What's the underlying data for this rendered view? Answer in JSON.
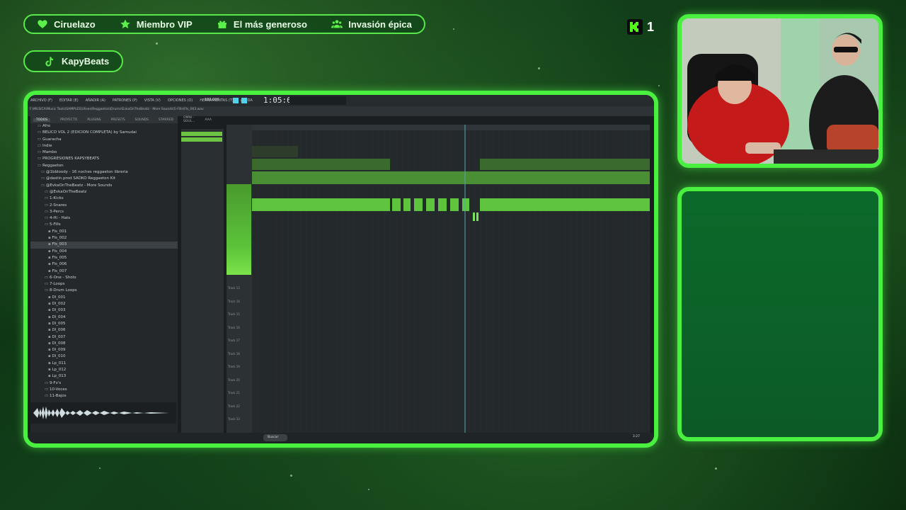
{
  "overlay": {
    "alerts": [
      {
        "icon": "heart-icon",
        "label": "Ciruelazo"
      },
      {
        "icon": "star-icon",
        "label": "Miembro VIP"
      },
      {
        "icon": "gift-icon",
        "label": "El más generoso"
      },
      {
        "icon": "users-icon",
        "label": "Invasión épica"
      }
    ],
    "social": {
      "icon": "tiktok-icon",
      "handle": "KapyBeats"
    },
    "kick": {
      "icon": "kick-logo-icon",
      "viewer_count": "1"
    },
    "colors": {
      "accent": "#49f040",
      "panel": "#0c5a26"
    }
  },
  "fl": {
    "menu": [
      "ARCHIVO (F)",
      "EDITAR (E)",
      "AÑADIR (A)",
      "PATRONES (P)",
      "VISTA (V)",
      "OPCIONES (O)",
      "HERRAMIENTAS (T)",
      "AYUDA"
    ],
    "time": "1:05:62",
    "bpm": "100.000",
    "path": "F:\\MUSICA\\Music Tools\\SAMPLES\\Ulises\\Reggaeton\\Drums\\EvkaOnTheBeatz - More Sounds\\5-Fills\\Fls_003.wav",
    "browser_tabs": [
      "TODOS",
      "PROYECTO",
      "PLUGINS",
      "PRESETS",
      "SOUNDS",
      "STARRED",
      "OMNI - SOUL...",
      "AAA"
    ],
    "browser_items": [
      {
        "label": "Afro",
        "indent": 2,
        "type": "folder"
      },
      {
        "label": "BELICO VOL 2 (EDICION COMPLETA) by Samudai",
        "indent": 2,
        "type": "folder"
      },
      {
        "label": "Guaracha",
        "indent": 2,
        "type": "folder"
      },
      {
        "label": "Indie",
        "indent": 2,
        "type": "folder"
      },
      {
        "label": "Mambo",
        "indent": 2,
        "type": "folder"
      },
      {
        "label": "PROGRESIONES KAPSYBEATS",
        "indent": 2,
        "type": "folder"
      },
      {
        "label": "Reggaeton",
        "indent": 2,
        "type": "folder"
      },
      {
        "label": "@1bbloody - 16 noches reggaeton libreria",
        "indent": 3,
        "type": "folder"
      },
      {
        "label": "@dastin.prod SADKO Reggaeton Kit",
        "indent": 3,
        "type": "folder"
      },
      {
        "label": "@EvkaOnTheBeatz - More Sounds",
        "indent": 3,
        "type": "folder"
      },
      {
        "label": "@EvkaOnTheBeatz",
        "indent": 4,
        "type": "folder"
      },
      {
        "label": "1-Kicks",
        "indent": 4,
        "type": "folder"
      },
      {
        "label": "2-Snares",
        "indent": 4,
        "type": "folder"
      },
      {
        "label": "3-Percs",
        "indent": 4,
        "type": "folder"
      },
      {
        "label": "4-Hi - Hats",
        "indent": 4,
        "type": "folder"
      },
      {
        "label": "5-Fills",
        "indent": 4,
        "type": "folder"
      },
      {
        "label": "Fls_001",
        "indent": 5,
        "type": "file"
      },
      {
        "label": "Fls_002",
        "indent": 5,
        "type": "file"
      },
      {
        "label": "Fls_003",
        "indent": 5,
        "type": "file",
        "selected": true
      },
      {
        "label": "Fls_004",
        "indent": 5,
        "type": "file"
      },
      {
        "label": "Fls_005",
        "indent": 5,
        "type": "file"
      },
      {
        "label": "Fls_006",
        "indent": 5,
        "type": "file"
      },
      {
        "label": "Fls_007",
        "indent": 5,
        "type": "file"
      },
      {
        "label": "6-One - Shots",
        "indent": 4,
        "type": "folder"
      },
      {
        "label": "7-Loops",
        "indent": 4,
        "type": "folder"
      },
      {
        "label": "8-Drum Loops",
        "indent": 4,
        "type": "folder"
      },
      {
        "label": "Dl_001",
        "indent": 5,
        "type": "file"
      },
      {
        "label": "Dl_002",
        "indent": 5,
        "type": "file"
      },
      {
        "label": "Dl_003",
        "indent": 5,
        "type": "file"
      },
      {
        "label": "Dl_004",
        "indent": 5,
        "type": "file"
      },
      {
        "label": "Dl_005",
        "indent": 5,
        "type": "file"
      },
      {
        "label": "Dl_006",
        "indent": 5,
        "type": "file"
      },
      {
        "label": "Dl_007",
        "indent": 5,
        "type": "file"
      },
      {
        "label": "Dl_008",
        "indent": 5,
        "type": "file"
      },
      {
        "label": "Dl_009",
        "indent": 5,
        "type": "file"
      },
      {
        "label": "Dl_010",
        "indent": 5,
        "type": "file"
      },
      {
        "label": "Lp_011",
        "indent": 5,
        "type": "file"
      },
      {
        "label": "Lp_012",
        "indent": 5,
        "type": "file"
      },
      {
        "label": "Lp_013",
        "indent": 5,
        "type": "file"
      },
      {
        "label": "9-Fx's",
        "indent": 4,
        "type": "folder"
      },
      {
        "label": "10-Voces",
        "indent": 4,
        "type": "folder"
      },
      {
        "label": "11-Bajos",
        "indent": 4,
        "type": "folder"
      }
    ],
    "playlist_title": "Playlist - Arrangement › Pt. #2",
    "track_labels": [
      "Track 13",
      "Track 14",
      "Track 15",
      "Track 16",
      "Track 17",
      "Track 18",
      "Track 19",
      "Track 20",
      "Track 21",
      "Track 22",
      "Track 23"
    ],
    "taskbar_search": "Buscar",
    "clock": "3:27"
  }
}
